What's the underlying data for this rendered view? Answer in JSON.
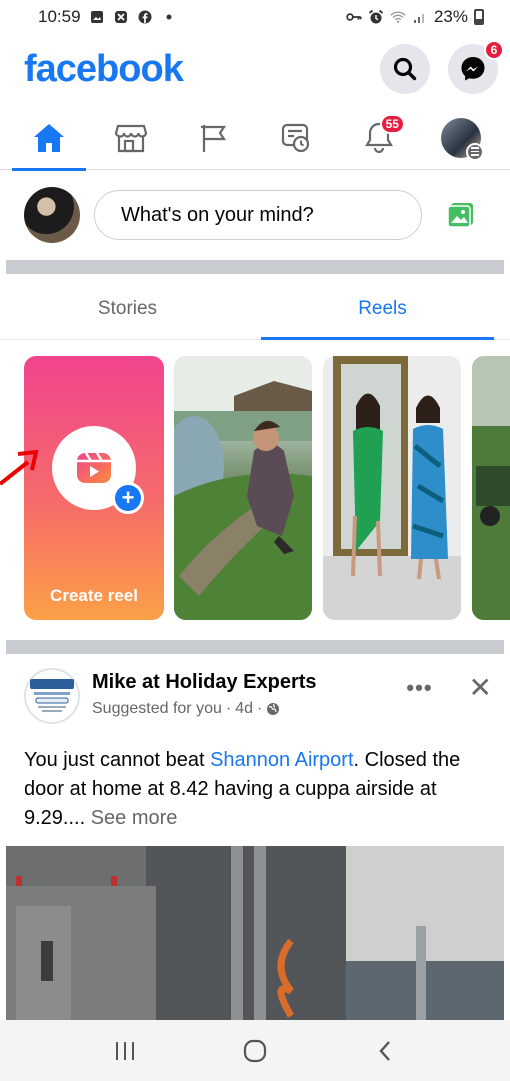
{
  "status_bar": {
    "time": "10:59",
    "battery": "23%"
  },
  "header": {
    "logo": "facebook",
    "messenger_badge": "6"
  },
  "nav": {
    "items": [
      {
        "name": "home",
        "active": true
      },
      {
        "name": "marketplace"
      },
      {
        "name": "pages"
      },
      {
        "name": "memories"
      },
      {
        "name": "notifications",
        "badge": "55"
      },
      {
        "name": "menu"
      }
    ]
  },
  "composer": {
    "placeholder": "What's on your mind?"
  },
  "story_tabs": {
    "stories": "Stories",
    "reels": "Reels"
  },
  "reels": {
    "create_label": "Create reel"
  },
  "post": {
    "author": "Mike at Holiday Experts",
    "suggested": "Suggested for you",
    "time": "4d",
    "separator": "·",
    "text_before": "You just cannot beat ",
    "link_text": "Shannon Airport",
    "text_after": ". Closed the door at home at 8.42 having a cuppa airside at 9.29.... ",
    "see_more": "See more",
    "more_glyph": "•••",
    "close_glyph": "✕"
  },
  "colors": {
    "brand": "#1877f2",
    "badge": "#e41e3f"
  }
}
